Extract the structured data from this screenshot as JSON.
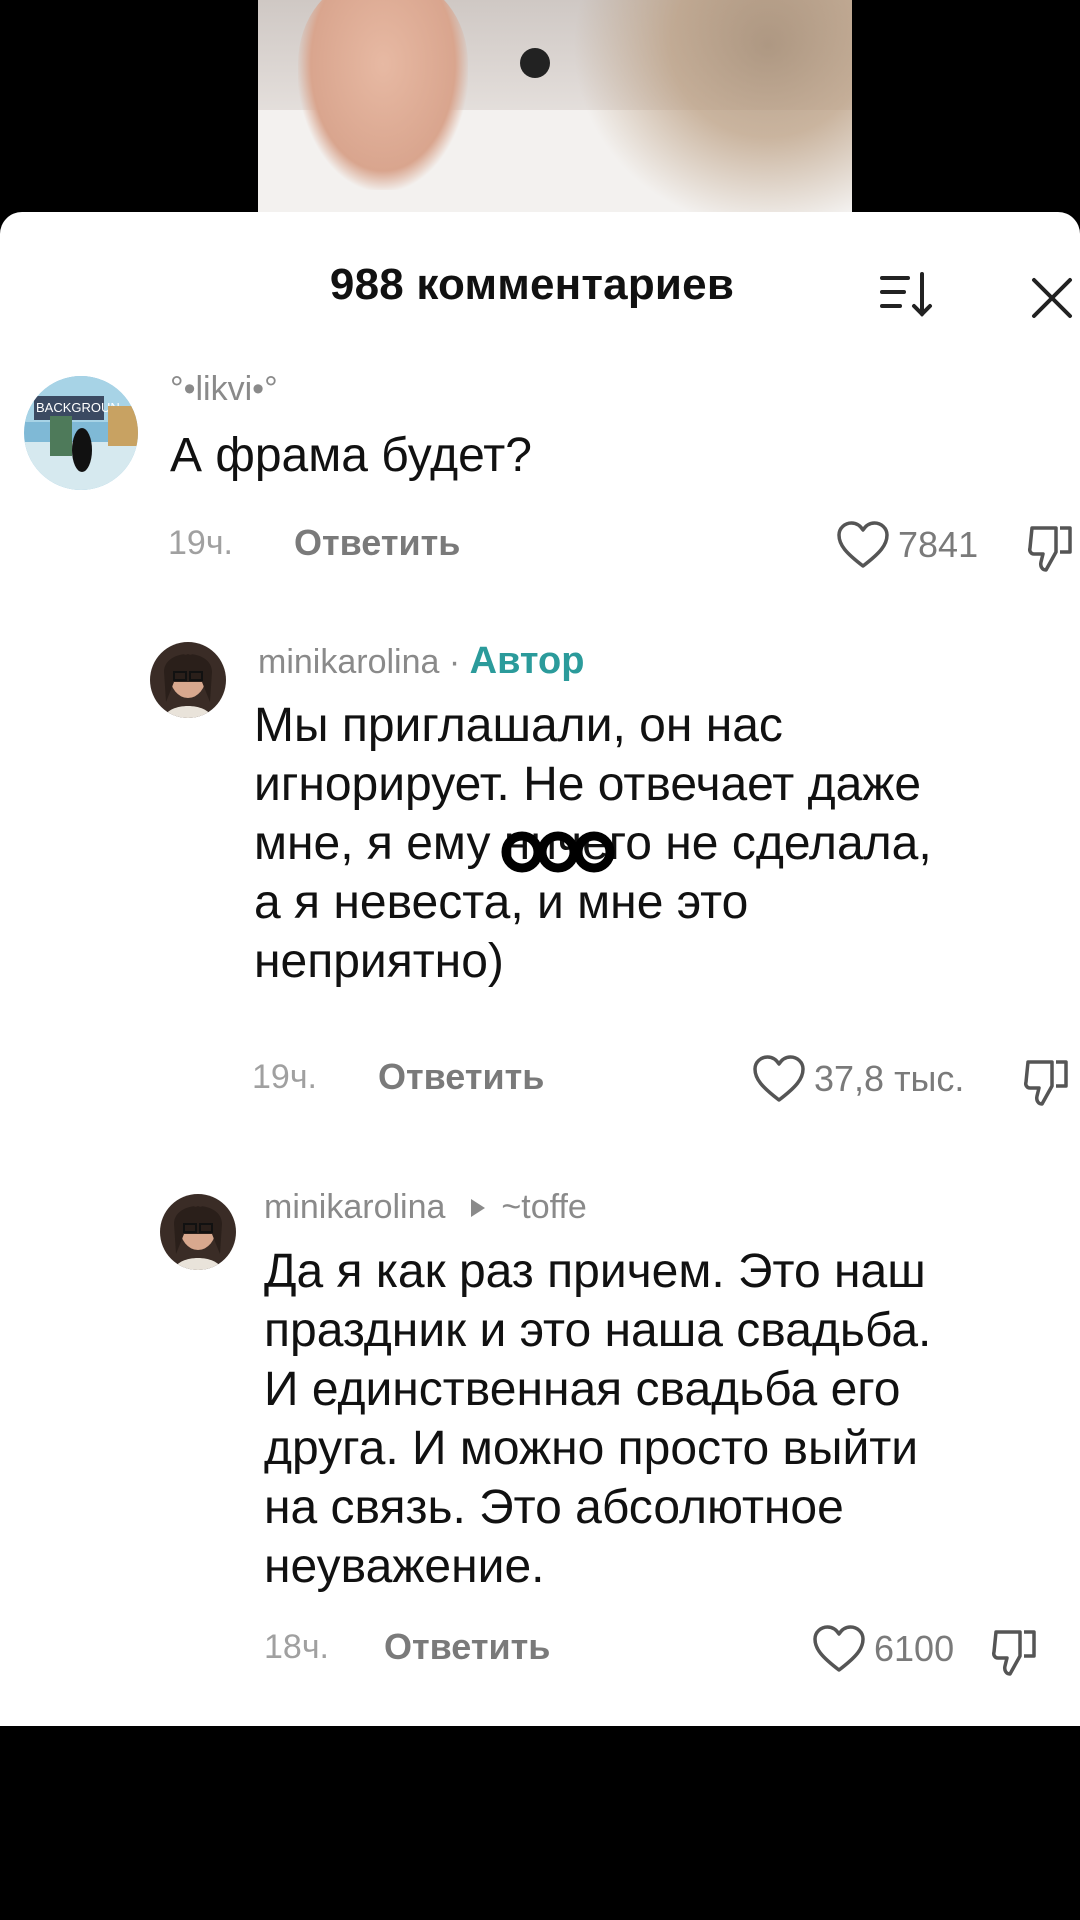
{
  "header": {
    "title": "988 комментариев"
  },
  "comments": [
    {
      "username": "°•likvi•°",
      "text": "А фрама будет?",
      "time": "19ч.",
      "reply_label": "Ответить",
      "likes": "7841"
    },
    {
      "username": "minikarolina",
      "separator": " · ",
      "badge": "Автор",
      "text": "Мы приглашали, он нас\nигнорирует. Не отвечает даже\nмне, я ему ничего не сделала,\nа я невеста, и мне это\nнеприятно)",
      "time": "19ч.",
      "reply_label": "Ответить",
      "likes": "37,8 тыс."
    },
    {
      "username": "minikarolina",
      "reply_to": "~toffe",
      "text": "Да я как раз причем. Это наш\nпраздник и это наша свадьба.\nИ единственная свадьба его\nдруга. И можно просто выйти\nна связь. Это абсолютное\nнеуважение.",
      "time": "18ч.",
      "reply_label": "Ответить",
      "likes": "6100"
    }
  ],
  "avatar_text": "BACKGROUN",
  "icons": [
    "sort-icon",
    "close-icon",
    "heart-icon",
    "dislike-icon",
    "more-dots-icon",
    "reply-arrow-icon"
  ]
}
